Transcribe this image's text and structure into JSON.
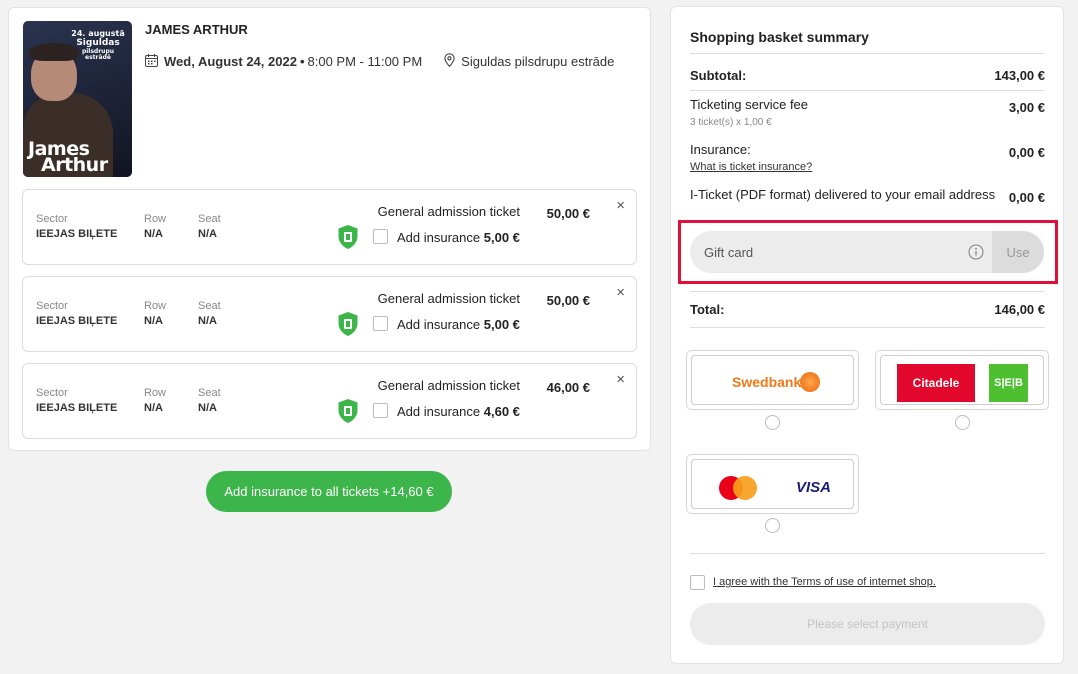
{
  "event": {
    "title": "JAMES ARTHUR",
    "date": "Wed, August 24, 2022",
    "separator": "•",
    "time": "8:00 PM - 11:00 PM",
    "venue": "Siguldas pilsdrupu estrāde",
    "poster": {
      "date_text": "24. augustā",
      "place_line1": "Siguldas",
      "place_line2": "pilsdrupu estrādē",
      "artist_line1": "James",
      "artist_line2": "Arthur"
    }
  },
  "tickets": [
    {
      "sector_label": "Sector",
      "sector": "IEEJAS BIĻETE",
      "row_label": "Row",
      "row": "N/A",
      "seat_label": "Seat",
      "seat": "N/A",
      "type": "General admission ticket",
      "price": "50,00 €",
      "insurance_label": "Add insurance",
      "insurance_price": "5,00 €",
      "close": "×"
    },
    {
      "sector_label": "Sector",
      "sector": "IEEJAS BIĻETE",
      "row_label": "Row",
      "row": "N/A",
      "seat_label": "Seat",
      "seat": "N/A",
      "type": "General admission ticket",
      "price": "50,00 €",
      "insurance_label": "Add insurance",
      "insurance_price": "5,00 €",
      "close": "×"
    },
    {
      "sector_label": "Sector",
      "sector": "IEEJAS BIĻETE",
      "row_label": "Row",
      "row": "N/A",
      "seat_label": "Seat",
      "seat": "N/A",
      "type": "General admission ticket",
      "price": "46,00 €",
      "insurance_label": "Add insurance",
      "insurance_price": "4,60 €",
      "close": "×"
    }
  ],
  "add_all_insurance": "Add insurance to all tickets +14,60 €",
  "summary": {
    "title": "Shopping basket summary",
    "subtotal_label": "Subtotal:",
    "subtotal": "143,00 €",
    "fee_label": "Ticketing service fee",
    "fee_detail": "3 ticket(s) x 1,00 €",
    "fee": "3,00 €",
    "insurance_label": "Insurance:",
    "insurance_link": "What is ticket insurance?",
    "insurance": "0,00 €",
    "delivery_label": "I-Ticket (PDF format) delivered to your email address",
    "delivery": "0,00 €",
    "gift_card_placeholder": "Gift card",
    "gift_card_use": "Use",
    "total_label": "Total:",
    "total": "146,00 €"
  },
  "payment": {
    "swedbank": "Swedbank",
    "citadele": "Citadele",
    "seb": "S|E|B",
    "visa": "VISA"
  },
  "terms": "I agree with the Terms of use of internet shop.",
  "pay_button": "Please select payment",
  "colors": {
    "green": "#3cb54a",
    "highlight": "#e0103a",
    "swedbank_orange": "#f07a1b",
    "citadele_red": "#e2072c",
    "seb_green": "#4ec02f"
  }
}
